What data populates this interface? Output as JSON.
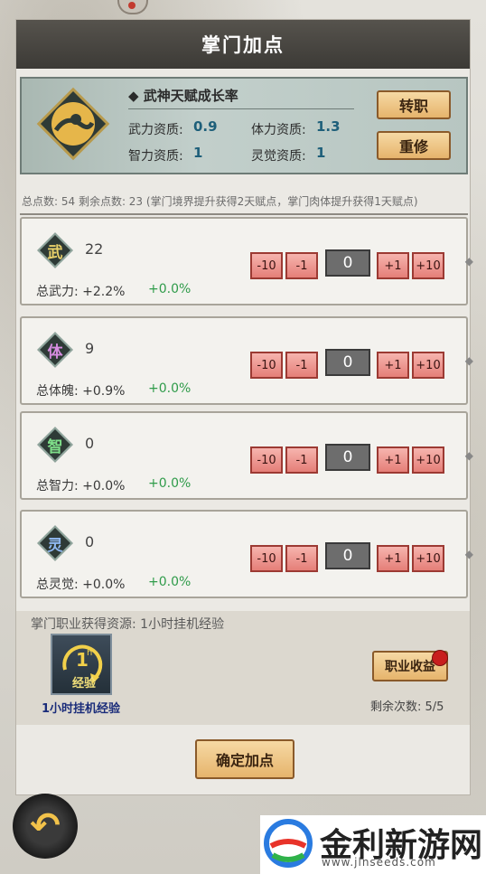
{
  "title": "掌门加点",
  "talent": {
    "name": "◆ 武神天赋成长率",
    "stats": [
      {
        "label": "武力资质:",
        "value": "0.9"
      },
      {
        "label": "体力资质:",
        "value": "1.3"
      },
      {
        "label": "智力资质:",
        "value": "1"
      },
      {
        "label": "灵觉资质:",
        "value": "1"
      }
    ],
    "buttons": {
      "switch": "转职",
      "rebuild": "重修"
    }
  },
  "summary": "总点数: 54   剩余点数: 23   (掌门境界提升获得2天赋点，掌门肉体提升获得1天赋点)",
  "steps": {
    "minus10": "-10",
    "minus1": "-1",
    "plus1": "+1",
    "plus10": "+10"
  },
  "cards": [
    {
      "icon": "武",
      "color": "#e8d06a",
      "value": "22",
      "label": "总武力: +2.2%",
      "gain": "+0.0%",
      "count": "0"
    },
    {
      "icon": "体",
      "color": "#d68ce0",
      "value": "9",
      "label": "总体魄: +0.9%",
      "gain": "+0.0%",
      "count": "0"
    },
    {
      "icon": "智",
      "color": "#7fe08a",
      "value": "0",
      "label": "总智力: +0.0%",
      "gain": "+0.0%",
      "count": "0"
    },
    {
      "icon": "灵",
      "color": "#8fb8f0",
      "value": "0",
      "label": "总灵觉: +0.0%",
      "gain": "+0.0%",
      "count": "0"
    }
  ],
  "resource": {
    "title": "掌门职业获得资源: 1小时挂机经验",
    "item_label": "1小时挂机经验",
    "item_badge": "经验",
    "income_button": "职业收益",
    "remaining": "剩余次数: 5/5"
  },
  "confirm": "确定加点",
  "watermark": {
    "name": "金利新游网",
    "url": "www.jlnseeds.com"
  }
}
